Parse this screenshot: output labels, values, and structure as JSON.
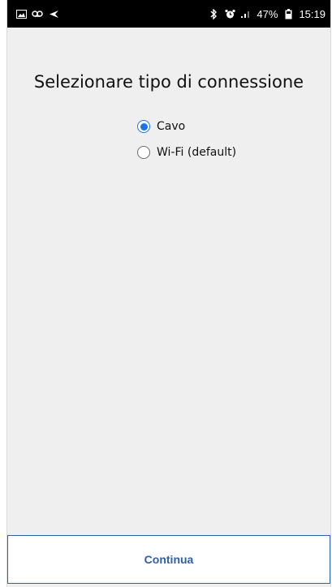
{
  "status_bar": {
    "left_icons": [
      "image-icon",
      "voicemail-icon",
      "send-icon"
    ],
    "right_icons": [
      "bluetooth-icon",
      "alarm-icon",
      "signal-icon",
      "battery-icon"
    ],
    "battery_percent": "47%",
    "time": "15:19"
  },
  "screen": {
    "title": "Selezionare tipo di connessione",
    "options": [
      {
        "label": "Cavo",
        "selected": true
      },
      {
        "label": "Wi-Fi (default)",
        "selected": false
      }
    ],
    "continue_label": "Continua",
    "accent_color": "#1a73e8",
    "button_text_color": "#2f5fa4"
  }
}
